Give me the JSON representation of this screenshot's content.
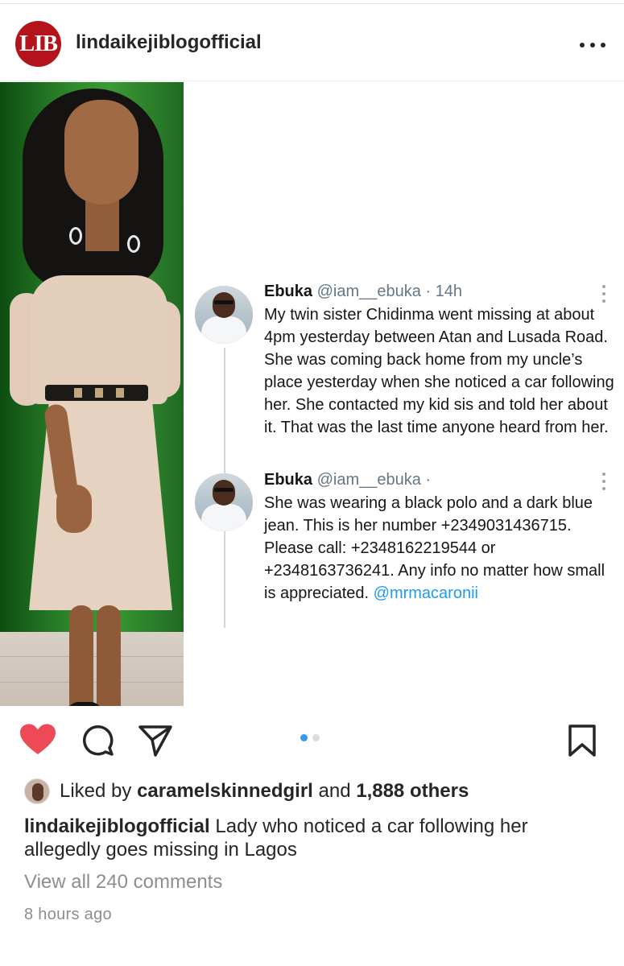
{
  "header": {
    "avatar_text": "LIB",
    "username": "lindaikejiblogofficial"
  },
  "tweets": [
    {
      "name": "Ebuka",
      "handle": "@iam__ebuka · 14h",
      "body": "My twin sister Chidinma went missing at about 4pm yesterday between Atan and Lusada Road. She was coming back home from my uncle’s place yesterday when she noticed a car following her. She contacted my kid sis and told her about it. That was the last time anyone heard from her."
    },
    {
      "name": "Ebuka",
      "handle": "@iam__ebuka ·",
      "body": "She was wearing a black polo and a dark blue jean. This is her number +2349031436715. Please call: +2348162219544 or +2348163736241. Any info no matter how small is appreciated.",
      "mention": "@mrmacaronii"
    }
  ],
  "carousel": {
    "count": 2,
    "active_index": 0,
    "active_color": "#3897f0",
    "inactive_color": "#dbdbdb"
  },
  "actions": {
    "liked": true,
    "like_color": "#ed4956",
    "icons": [
      "heart-icon",
      "comment-icon",
      "share-icon",
      "bookmark-icon"
    ]
  },
  "likes": {
    "prefix": "Liked by",
    "user": "caramelskinnedgirl",
    "joiner": "and",
    "others": "1,888 others"
  },
  "caption": {
    "username": "lindaikejiblogofficial",
    "text": "Lady who noticed a car following her allegedly goes missing in Lagos"
  },
  "comments_link": "View all 240 comments",
  "timestamp": "8 hours ago"
}
